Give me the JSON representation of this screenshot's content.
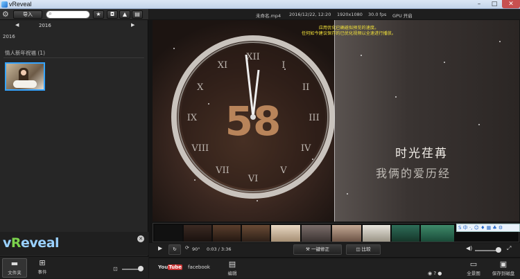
{
  "window": {
    "title": "vReveal",
    "min": "–",
    "max": "□",
    "close": "✕"
  },
  "left": {
    "import_label": "导入",
    "search_placeholder": "",
    "year": "2016",
    "year_label": "2016",
    "event_title": "情人新年祝福 (1)",
    "logo_v": "v",
    "logo_R": "R",
    "logo_rest": "eveal",
    "tabs": [
      {
        "label": "文件夹",
        "icon": "folder-icon"
      },
      {
        "label": "事件",
        "icon": "grid-icon"
      }
    ]
  },
  "video": {
    "info": {
      "filename": "未命名.mp4",
      "datetime": "2016/12/22, 12:20",
      "resolution": "1920x1080",
      "fps": "30.0 fps",
      "gpu": "GPU 开启"
    },
    "notice_line1": "应用优化已确避拟预览的速度。",
    "notice_line2": "任何如今建议保存的已优化视频以全速进行播放。",
    "clock_number": "58",
    "roman": [
      "XII",
      "I",
      "II",
      "III",
      "IV",
      "V",
      "VI",
      "VII",
      "VIII",
      "IX",
      "X",
      "XI"
    ],
    "caption1": "时光荏苒",
    "caption2": "我俩的爱历经",
    "ime": "S 中 ·, ☺ ♦ ▦ ♣ ⚙"
  },
  "controls": {
    "rotate": "90°",
    "time": "0:03 / 3:36",
    "fix_label": "一键修正",
    "compare_label": "比较"
  },
  "bottom": {
    "youtube_you": "You",
    "youtube_tube": "Tube",
    "facebook": "facebook",
    "edit_label": "编辑",
    "fullscreen_label": "全景图",
    "save_label": "保存到磁盘"
  }
}
